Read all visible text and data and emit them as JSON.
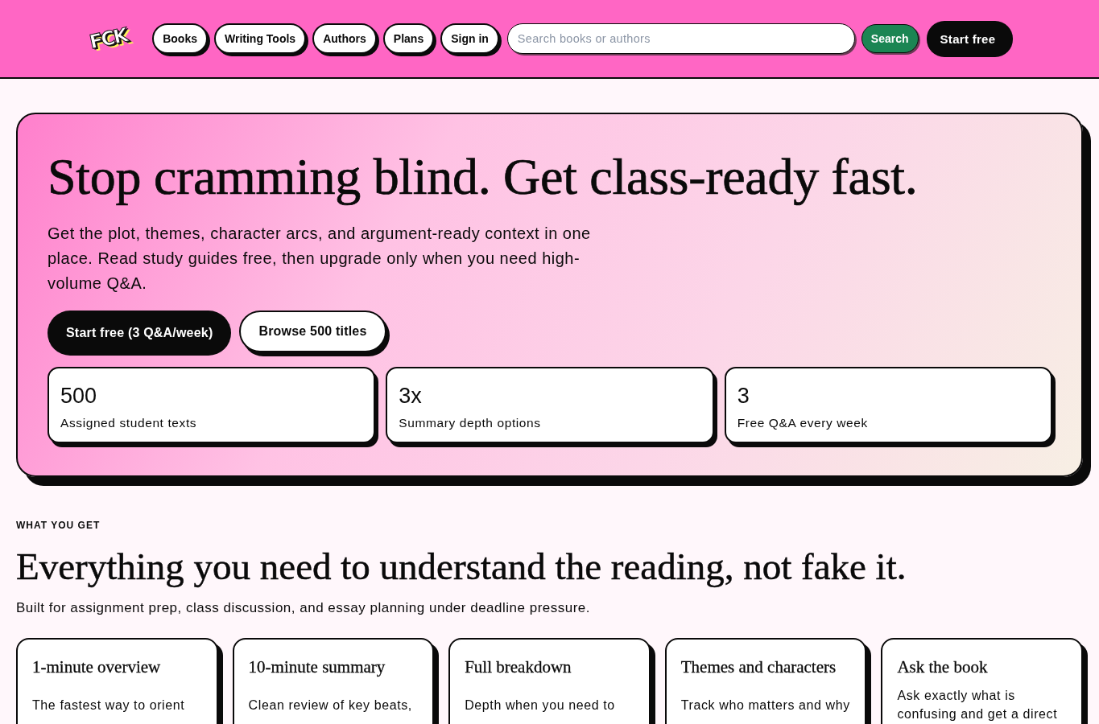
{
  "header": {
    "logo": "FCK",
    "nav": [
      "Books",
      "Writing Tools",
      "Authors",
      "Plans",
      "Sign in"
    ],
    "search": {
      "placeholder": "Search books or authors",
      "button": "Search"
    },
    "cta": "Start free"
  },
  "hero": {
    "title": "Stop cramming blind. Get class-ready fast.",
    "text": "Get the plot, themes, character arcs, and argument-ready context in one place. Read study guides free, then upgrade only when you need high-volume Q&A.",
    "buttons": [
      {
        "label": "Start free (3 Q&A/week)",
        "kind": "primary"
      },
      {
        "label": "Browse 500 titles",
        "kind": "secondary"
      }
    ],
    "stats": [
      {
        "value": "500",
        "label": "Assigned student texts"
      },
      {
        "value": "3x",
        "label": "Summary depth options"
      },
      {
        "value": "3",
        "label": "Free Q&A every week"
      }
    ]
  },
  "features": {
    "eyebrow": "WHAT YOU GET",
    "title": "Everything you need to understand the reading, not fake it.",
    "subtitle": "Built for assignment prep, class discussion, and essay planning under deadline pressure.",
    "cards": [
      {
        "title": "1-minute overview",
        "text": "The fastest way to orient"
      },
      {
        "title": "10-minute summary",
        "text": "Clean review of key beats,"
      },
      {
        "title": "Full breakdown",
        "text": "Depth when you need to"
      },
      {
        "title": "Themes and characters",
        "text": "Track who matters and why"
      },
      {
        "title": "Ask the book",
        "text": "Ask exactly what is confusing and get a direct"
      }
    ]
  }
}
